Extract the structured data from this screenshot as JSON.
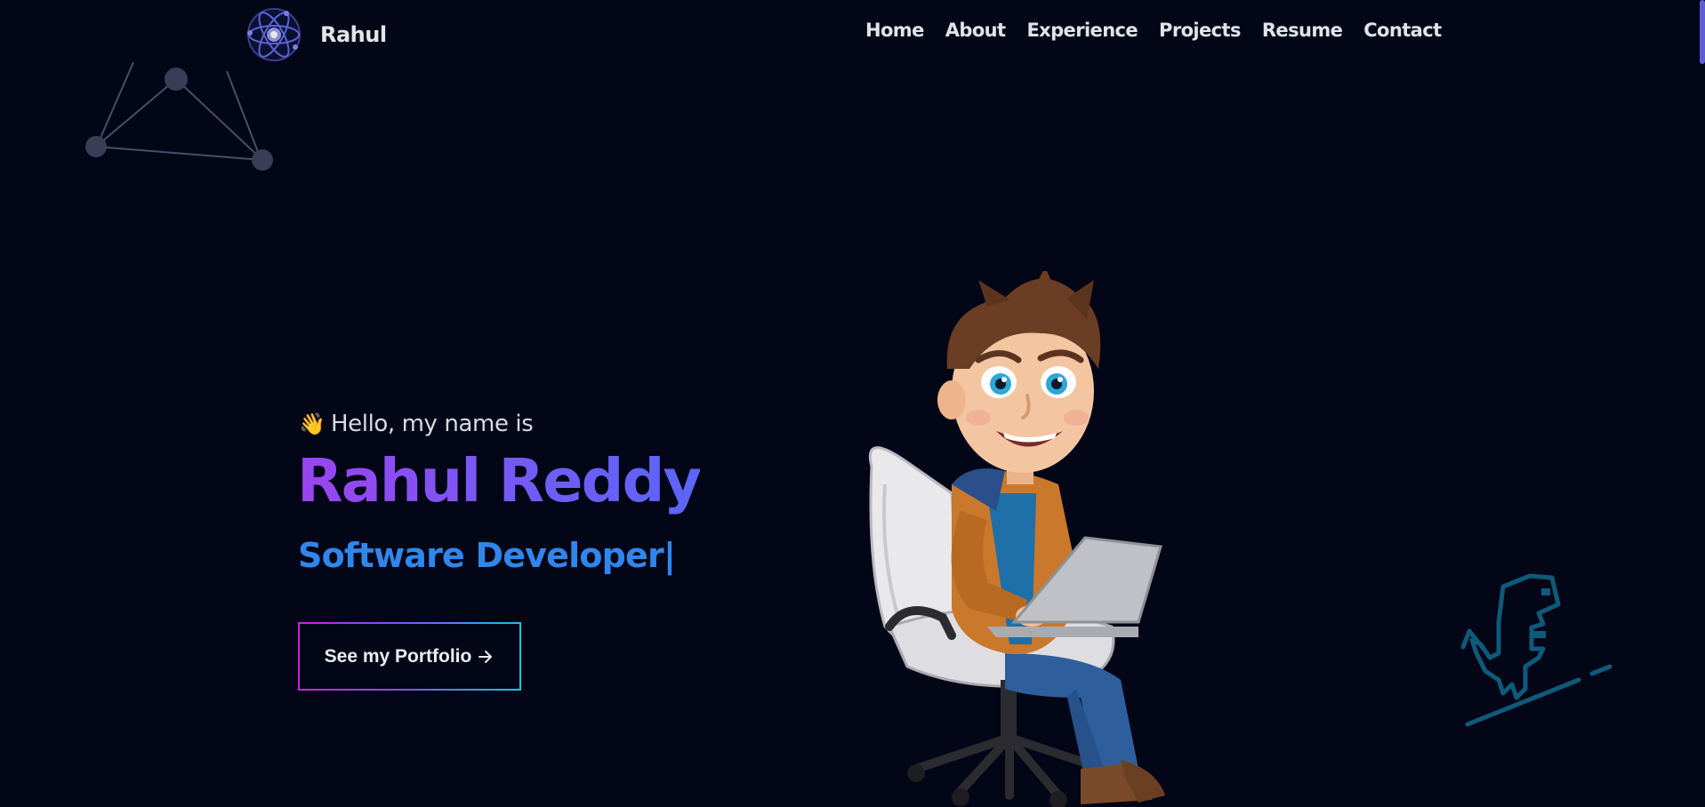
{
  "navbar": {
    "brand_name": "Rahul",
    "logo_icon": "atom-logo-icon",
    "links": [
      {
        "label": "Home"
      },
      {
        "label": "About"
      },
      {
        "label": "Experience"
      },
      {
        "label": "Projects"
      },
      {
        "label": "Resume"
      },
      {
        "label": "Contact"
      }
    ]
  },
  "hero": {
    "wave_icon": "👋",
    "greeting": "Hello, my name is",
    "name": "Rahul Reddy",
    "role": "Software Developer",
    "cursor": "|",
    "cta_label": "See my Portfolio"
  },
  "colors": {
    "background": "#030617",
    "name_gradient_start": "#9b44ee",
    "name_gradient_end": "#5a66f7",
    "role": "#2f87ec",
    "dino_stroke": "#0e5a7a",
    "scroll_thumb": "#5a5fd6"
  },
  "illustrations": {
    "character": "cartoon-developer-on-chair-with-laptop",
    "dino": "dino-on-skateboard-icon",
    "network": "network-graph-decoration"
  }
}
